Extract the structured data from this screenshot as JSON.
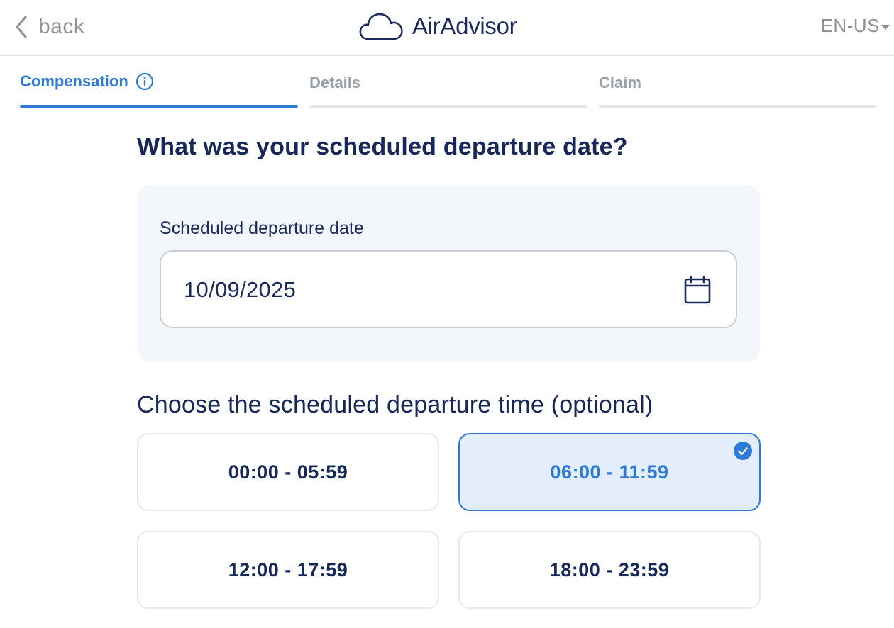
{
  "header": {
    "back_label": "back",
    "logo_text": "AirAdvisor",
    "language": "EN-US"
  },
  "steps": [
    {
      "label": "Compensation",
      "active": true
    },
    {
      "label": "Details",
      "active": false
    },
    {
      "label": "Claim",
      "active": false
    }
  ],
  "date_section": {
    "question_parts": [
      "What was your ",
      "scheduled departure",
      " date?"
    ],
    "field_label": "Scheduled departure date",
    "date_value": "10/09/2025"
  },
  "time_section": {
    "question": "Choose the scheduled departure time (optional)",
    "slots": [
      {
        "label": "00:00 - 05:59",
        "selected": false
      },
      {
        "label": "06:00 - 11:59",
        "selected": true
      },
      {
        "label": "12:00 - 17:59",
        "selected": false
      },
      {
        "label": "18:00 - 23:59",
        "selected": false
      }
    ]
  },
  "colors": {
    "accent": "#2d7ad8",
    "navy": "#16275a",
    "muted": "#8d929b",
    "card_bg": "#f3f7fc",
    "selected_bg": "#e3edfb"
  },
  "icons": [
    "chevron-left-icon",
    "cloud-logo-icon",
    "caret-down-icon",
    "info-icon",
    "calendar-icon",
    "checkmark-circle-icon"
  ]
}
